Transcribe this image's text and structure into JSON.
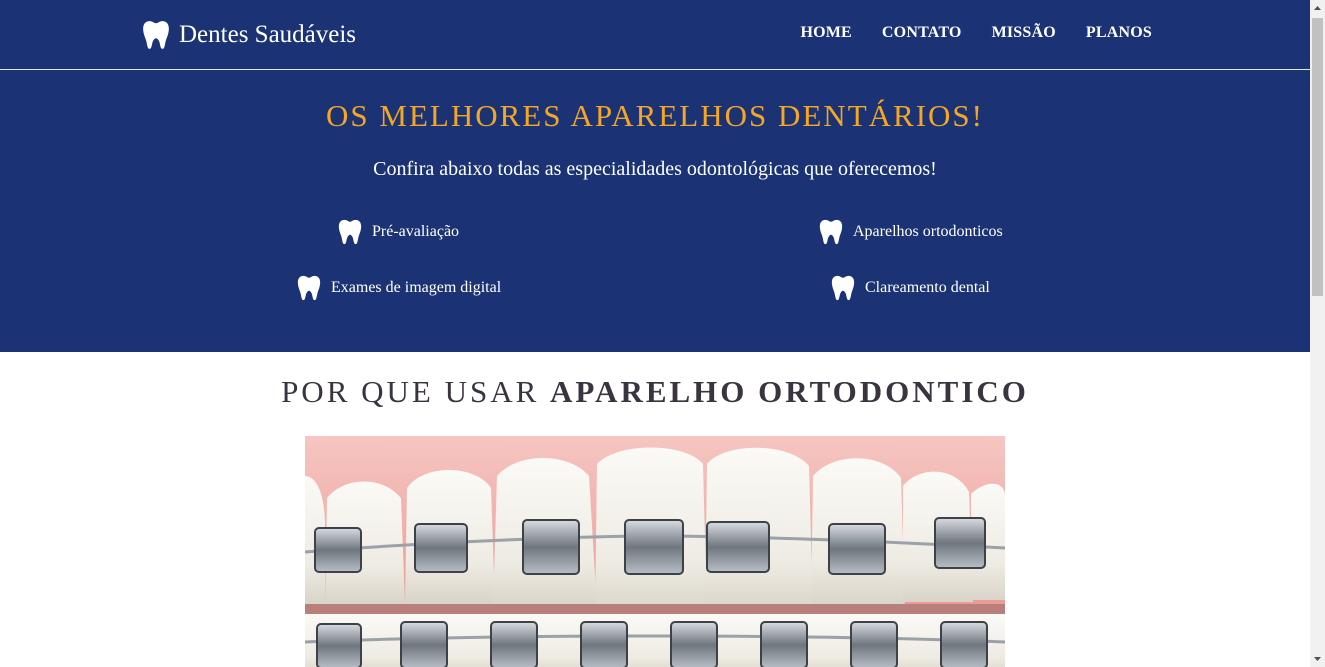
{
  "brand": {
    "name": "Dentes Saudáveis",
    "icon": "tooth-icon"
  },
  "nav": {
    "items": [
      "HOME",
      "CONTATO",
      "MISSÃO",
      "PLANOS"
    ]
  },
  "hero": {
    "title": "OS MELHORES APARELHOS DENTÁRIOS!",
    "subtitle": "Confira abaixo todas as especialidades odontológicas que oferecemos!",
    "services": [
      "Pré-avaliação",
      "Aparelhos ortodonticos",
      "Exames de imagem digital",
      "Clareamento dental"
    ]
  },
  "section": {
    "title_light": "POR QUE USAR ",
    "title_bold": "APARELHO ORTODONTICO"
  },
  "colors": {
    "header_bg": "#1b3374",
    "accent": "#f5a623",
    "text_light": "#ffffff",
    "heading_dark": "#3a3340"
  }
}
